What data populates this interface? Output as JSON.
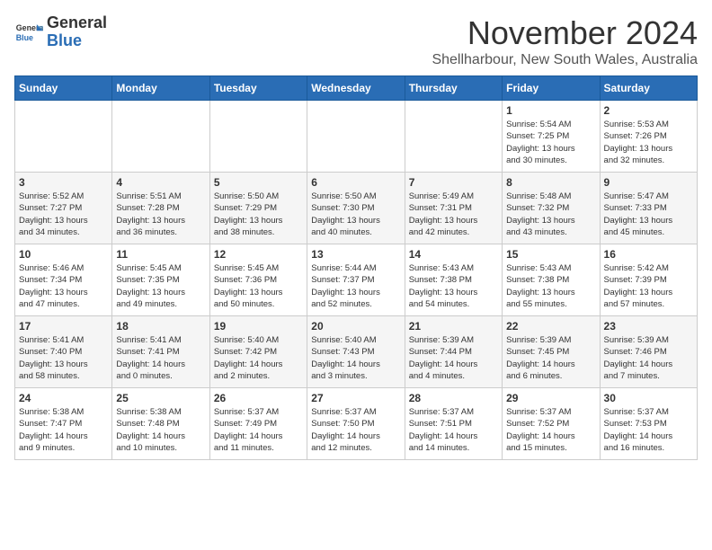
{
  "header": {
    "logo_line1": "General",
    "logo_line2": "Blue",
    "month_year": "November 2024",
    "location": "Shellharbour, New South Wales, Australia"
  },
  "days_of_week": [
    "Sunday",
    "Monday",
    "Tuesday",
    "Wednesday",
    "Thursday",
    "Friday",
    "Saturday"
  ],
  "weeks": [
    [
      {
        "day": "",
        "info": ""
      },
      {
        "day": "",
        "info": ""
      },
      {
        "day": "",
        "info": ""
      },
      {
        "day": "",
        "info": ""
      },
      {
        "day": "",
        "info": ""
      },
      {
        "day": "1",
        "info": "Sunrise: 5:54 AM\nSunset: 7:25 PM\nDaylight: 13 hours\nand 30 minutes."
      },
      {
        "day": "2",
        "info": "Sunrise: 5:53 AM\nSunset: 7:26 PM\nDaylight: 13 hours\nand 32 minutes."
      }
    ],
    [
      {
        "day": "3",
        "info": "Sunrise: 5:52 AM\nSunset: 7:27 PM\nDaylight: 13 hours\nand 34 minutes."
      },
      {
        "day": "4",
        "info": "Sunrise: 5:51 AM\nSunset: 7:28 PM\nDaylight: 13 hours\nand 36 minutes."
      },
      {
        "day": "5",
        "info": "Sunrise: 5:50 AM\nSunset: 7:29 PM\nDaylight: 13 hours\nand 38 minutes."
      },
      {
        "day": "6",
        "info": "Sunrise: 5:50 AM\nSunset: 7:30 PM\nDaylight: 13 hours\nand 40 minutes."
      },
      {
        "day": "7",
        "info": "Sunrise: 5:49 AM\nSunset: 7:31 PM\nDaylight: 13 hours\nand 42 minutes."
      },
      {
        "day": "8",
        "info": "Sunrise: 5:48 AM\nSunset: 7:32 PM\nDaylight: 13 hours\nand 43 minutes."
      },
      {
        "day": "9",
        "info": "Sunrise: 5:47 AM\nSunset: 7:33 PM\nDaylight: 13 hours\nand 45 minutes."
      }
    ],
    [
      {
        "day": "10",
        "info": "Sunrise: 5:46 AM\nSunset: 7:34 PM\nDaylight: 13 hours\nand 47 minutes."
      },
      {
        "day": "11",
        "info": "Sunrise: 5:45 AM\nSunset: 7:35 PM\nDaylight: 13 hours\nand 49 minutes."
      },
      {
        "day": "12",
        "info": "Sunrise: 5:45 AM\nSunset: 7:36 PM\nDaylight: 13 hours\nand 50 minutes."
      },
      {
        "day": "13",
        "info": "Sunrise: 5:44 AM\nSunset: 7:37 PM\nDaylight: 13 hours\nand 52 minutes."
      },
      {
        "day": "14",
        "info": "Sunrise: 5:43 AM\nSunset: 7:38 PM\nDaylight: 13 hours\nand 54 minutes."
      },
      {
        "day": "15",
        "info": "Sunrise: 5:43 AM\nSunset: 7:38 PM\nDaylight: 13 hours\nand 55 minutes."
      },
      {
        "day": "16",
        "info": "Sunrise: 5:42 AM\nSunset: 7:39 PM\nDaylight: 13 hours\nand 57 minutes."
      }
    ],
    [
      {
        "day": "17",
        "info": "Sunrise: 5:41 AM\nSunset: 7:40 PM\nDaylight: 13 hours\nand 58 minutes."
      },
      {
        "day": "18",
        "info": "Sunrise: 5:41 AM\nSunset: 7:41 PM\nDaylight: 14 hours\nand 0 minutes."
      },
      {
        "day": "19",
        "info": "Sunrise: 5:40 AM\nSunset: 7:42 PM\nDaylight: 14 hours\nand 2 minutes."
      },
      {
        "day": "20",
        "info": "Sunrise: 5:40 AM\nSunset: 7:43 PM\nDaylight: 14 hours\nand 3 minutes."
      },
      {
        "day": "21",
        "info": "Sunrise: 5:39 AM\nSunset: 7:44 PM\nDaylight: 14 hours\nand 4 minutes."
      },
      {
        "day": "22",
        "info": "Sunrise: 5:39 AM\nSunset: 7:45 PM\nDaylight: 14 hours\nand 6 minutes."
      },
      {
        "day": "23",
        "info": "Sunrise: 5:39 AM\nSunset: 7:46 PM\nDaylight: 14 hours\nand 7 minutes."
      }
    ],
    [
      {
        "day": "24",
        "info": "Sunrise: 5:38 AM\nSunset: 7:47 PM\nDaylight: 14 hours\nand 9 minutes."
      },
      {
        "day": "25",
        "info": "Sunrise: 5:38 AM\nSunset: 7:48 PM\nDaylight: 14 hours\nand 10 minutes."
      },
      {
        "day": "26",
        "info": "Sunrise: 5:37 AM\nSunset: 7:49 PM\nDaylight: 14 hours\nand 11 minutes."
      },
      {
        "day": "27",
        "info": "Sunrise: 5:37 AM\nSunset: 7:50 PM\nDaylight: 14 hours\nand 12 minutes."
      },
      {
        "day": "28",
        "info": "Sunrise: 5:37 AM\nSunset: 7:51 PM\nDaylight: 14 hours\nand 14 minutes."
      },
      {
        "day": "29",
        "info": "Sunrise: 5:37 AM\nSunset: 7:52 PM\nDaylight: 14 hours\nand 15 minutes."
      },
      {
        "day": "30",
        "info": "Sunrise: 5:37 AM\nSunset: 7:53 PM\nDaylight: 14 hours\nand 16 minutes."
      }
    ]
  ]
}
